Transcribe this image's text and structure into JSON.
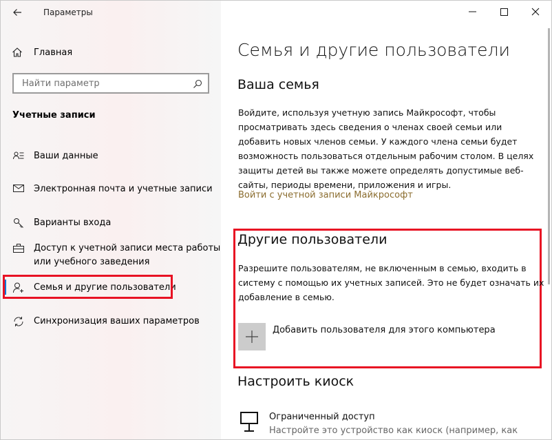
{
  "window": {
    "title": "Параметры",
    "controls": {
      "minimize": "—",
      "maximize": "☐",
      "close": "✕"
    }
  },
  "sidebar": {
    "home_label": "Главная",
    "search_placeholder": "Найти параметр",
    "section_title": "Учетные записи",
    "items": [
      {
        "label": "Ваши данные",
        "icon": "user-info-icon"
      },
      {
        "label": "Электронная почта и учетные записи",
        "icon": "mail-icon"
      },
      {
        "label": "Варианты входа",
        "icon": "key-icon"
      },
      {
        "label": "Доступ к учетной записи места работы",
        "label2": "или учебного заведения",
        "icon": "briefcase-icon"
      },
      {
        "label": "Семья и другие пользователи",
        "icon": "person-add-icon",
        "selected": true
      },
      {
        "label": "Синхронизация ваших параметров",
        "icon": "sync-icon"
      }
    ]
  },
  "main": {
    "title": "Семья и другие пользователи",
    "family": {
      "heading": "Ваша семья",
      "lines": [
        "Войдите, используя учетную запись Майкрософт, чтобы",
        "просматривать здесь сведения о членах своей семьи или",
        "добавить новых членов семьи. У каждого члена семьи будет",
        "возможность пользоваться отдельным рабочим столом. В целях",
        "защиты детей вы также можете определять допустимые веб-",
        "сайты, периоды времени, приложения и игры."
      ],
      "link": "Войти с учетной записи Майкрософт"
    },
    "others": {
      "heading": "Другие пользователи",
      "lines": [
        "Разрешите пользователям, не включенным в семью, входить в",
        "систему с помощью их учетных записей. Это не будет означать их",
        "добавление в семью."
      ],
      "add_label": "Добавить пользователя для этого компьютера"
    },
    "kiosk": {
      "heading": "Настроить киоск",
      "item_title": "Ограниченный доступ",
      "item_desc": "Настройте это устройство как киоск (например, как"
    }
  },
  "colors": {
    "highlight": "#e81123",
    "accent": "#0078d7",
    "link": "#8b6d2f"
  }
}
